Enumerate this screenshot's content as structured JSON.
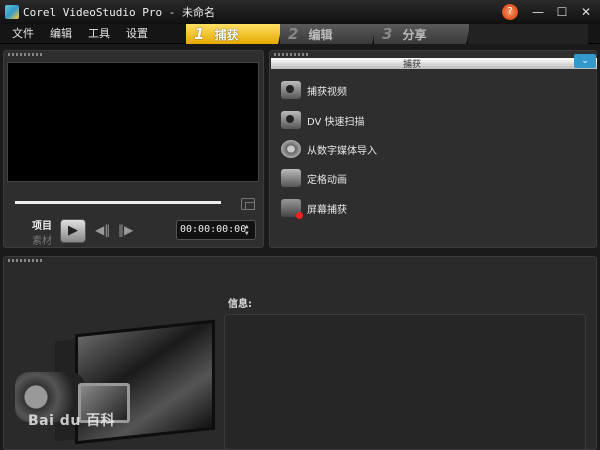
{
  "window": {
    "title": "Corel VideoStudio Pro - 未命名",
    "help_symbol": "?",
    "controls": {
      "minimize": "—",
      "maximize": "☐",
      "close": "✕"
    }
  },
  "menu": [
    "文件",
    "编辑",
    "工具",
    "设置"
  ],
  "steps": [
    {
      "number": "1",
      "label": "捕获",
      "active": true
    },
    {
      "number": "2",
      "label": "编辑",
      "active": false
    },
    {
      "number": "3",
      "label": "分享",
      "active": false
    }
  ],
  "preview": {
    "mode_project": "项目",
    "mode_clip": "素材",
    "play_symbol": "▶",
    "prev_symbol": "◀‖",
    "next_symbol": "‖▶",
    "timecode": "00:00:00:00"
  },
  "capture": {
    "header": "捕获",
    "collapse_symbol": "⌄",
    "items": [
      {
        "label": "捕获视频",
        "icon": "video-camera-icon"
      },
      {
        "label": "DV 快速扫描",
        "icon": "dv-scan-icon"
      },
      {
        "label": "从数字媒体导入",
        "icon": "disc-import-icon"
      },
      {
        "label": "定格动画",
        "icon": "stop-motion-icon"
      },
      {
        "label": "屏幕捕获",
        "icon": "screen-capture-icon"
      }
    ]
  },
  "info": {
    "label": "信息:"
  },
  "watermark": "Bai du 百科"
}
